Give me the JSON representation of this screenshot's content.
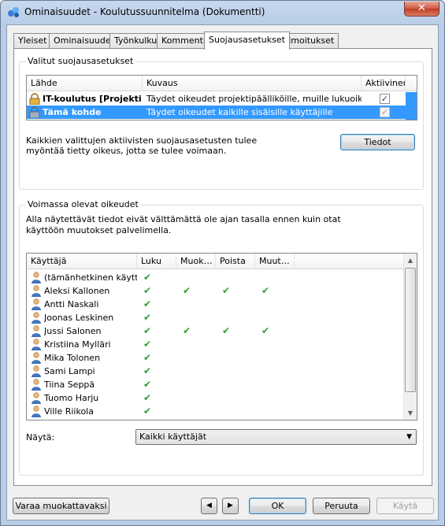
{
  "window": {
    "title": "Ominaisuudet - Koulutussuunnitelma (Dokumentti)",
    "close": "✕"
  },
  "tabs": [
    {
      "label": "Yleiset"
    },
    {
      "label": "Ominaisuudet"
    },
    {
      "label": "Työnkulku"
    },
    {
      "label": "Kommentit"
    },
    {
      "label": "Suojausasetukset"
    },
    {
      "label": "Ilmoitukset"
    }
  ],
  "active_tab": "Suojausasetukset",
  "selected_settings": {
    "group_title": "Valitut suojausasetukset",
    "columns": [
      "Lähde",
      "Kuvaus",
      "Aktiivinen"
    ],
    "rows": [
      {
        "source": "IT-koulutus [Projekti]",
        "description": "Täydet oikeudet projektipäälliköille, muille lukuoikeudet",
        "active": true,
        "selected": false
      },
      {
        "source": "Tämä kohde",
        "description": "Täydet oikeudet kaikille sisäisille käyttäjille",
        "active": true,
        "selected": true
      }
    ],
    "info_text_line1": "Kaikkien valittujen aktiivisten suojausasetusten tulee",
    "info_text_line2": "myöntää tietty oikeus, jotta se tulee voimaan.",
    "details_button": "Tiedot"
  },
  "effective_rights": {
    "group_title": "Voimassa olevat oikeudet",
    "note_line1": "Alla näytettävät tiedot eivät välttämättä ole ajan tasalla ennen kuin otat",
    "note_line2": "käyttöön muutokset palvelimella.",
    "columns": [
      "Käyttäjä",
      "Luku",
      "Muok…",
      "Poista",
      "Muut…"
    ],
    "rows": [
      {
        "user": "(tämänhetkinen käytt…",
        "rights": [
          true,
          false,
          false,
          false
        ]
      },
      {
        "user": "Aleksi Kallonen",
        "rights": [
          true,
          true,
          true,
          true
        ]
      },
      {
        "user": "Antti Naskali",
        "rights": [
          true,
          false,
          false,
          false
        ]
      },
      {
        "user": "Joonas Leskinen",
        "rights": [
          true,
          false,
          false,
          false
        ]
      },
      {
        "user": "Jussi Salonen",
        "rights": [
          true,
          true,
          true,
          true
        ]
      },
      {
        "user": "Kristiina Mylläri",
        "rights": [
          true,
          false,
          false,
          false
        ]
      },
      {
        "user": "Mika Tolonen",
        "rights": [
          true,
          false,
          false,
          false
        ]
      },
      {
        "user": "Sami Lampi",
        "rights": [
          true,
          false,
          false,
          false
        ]
      },
      {
        "user": "Tiina Seppä",
        "rights": [
          true,
          false,
          false,
          false
        ]
      },
      {
        "user": "Tuomo Harju",
        "rights": [
          true,
          false,
          false,
          false
        ]
      },
      {
        "user": "Ville Riikola",
        "rights": [
          true,
          false,
          false,
          false
        ]
      }
    ],
    "show_label": "Näytä:",
    "show_value": "Kaikki käyttäjät"
  },
  "footer": {
    "reserve_button": "Varaa muokattavaksi",
    "prev": "◀",
    "next": "▶",
    "ok": "OK",
    "cancel": "Peruuta",
    "apply": "Käytä"
  },
  "colors": {
    "selection": "#3399ff",
    "check": "#2e9e2e"
  }
}
